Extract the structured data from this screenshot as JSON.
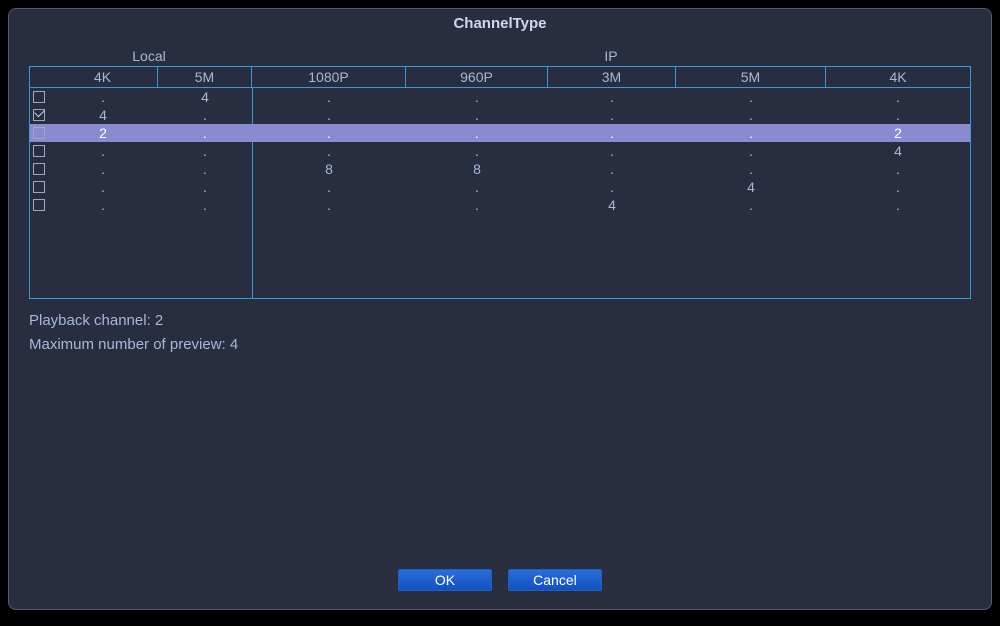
{
  "title": "ChannelType",
  "groups": {
    "local": "Local",
    "ip": "IP"
  },
  "columns": {
    "local_4k": "4K",
    "local_5m": "5M",
    "ip_1080p": "1080P",
    "ip_960p": "960P",
    "ip_3m": "3M",
    "ip_5m": "5M",
    "ip_4k": "4K"
  },
  "rows": [
    {
      "checked": false,
      "local_4k": ".",
      "local_5m": "4",
      "ip_1080p": ".",
      "ip_960p": ".",
      "ip_3m": ".",
      "ip_5m": ".",
      "ip_4k": "."
    },
    {
      "checked": true,
      "local_4k": "4",
      "local_5m": ".",
      "ip_1080p": ".",
      "ip_960p": ".",
      "ip_3m": ".",
      "ip_5m": ".",
      "ip_4k": "."
    },
    {
      "checked": false,
      "selected": true,
      "local_4k": "2",
      "local_5m": ".",
      "ip_1080p": ".",
      "ip_960p": ".",
      "ip_3m": ".",
      "ip_5m": ".",
      "ip_4k": "2"
    },
    {
      "checked": false,
      "local_4k": ".",
      "local_5m": ".",
      "ip_1080p": ".",
      "ip_960p": ".",
      "ip_3m": ".",
      "ip_5m": ".",
      "ip_4k": "4"
    },
    {
      "checked": false,
      "local_4k": ".",
      "local_5m": ".",
      "ip_1080p": "8",
      "ip_960p": "8",
      "ip_3m": ".",
      "ip_5m": ".",
      "ip_4k": "."
    },
    {
      "checked": false,
      "local_4k": ".",
      "local_5m": ".",
      "ip_1080p": ".",
      "ip_960p": ".",
      "ip_3m": ".",
      "ip_5m": "4",
      "ip_4k": "."
    },
    {
      "checked": false,
      "local_4k": ".",
      "local_5m": ".",
      "ip_1080p": ".",
      "ip_960p": ".",
      "ip_3m": "4",
      "ip_5m": ".",
      "ip_4k": "."
    }
  ],
  "info": {
    "playback_label": "Playback channel: ",
    "playback_value": "2",
    "preview_label": "Maximum number of preview: ",
    "preview_value": "4"
  },
  "buttons": {
    "ok": "OK",
    "cancel": "Cancel"
  }
}
